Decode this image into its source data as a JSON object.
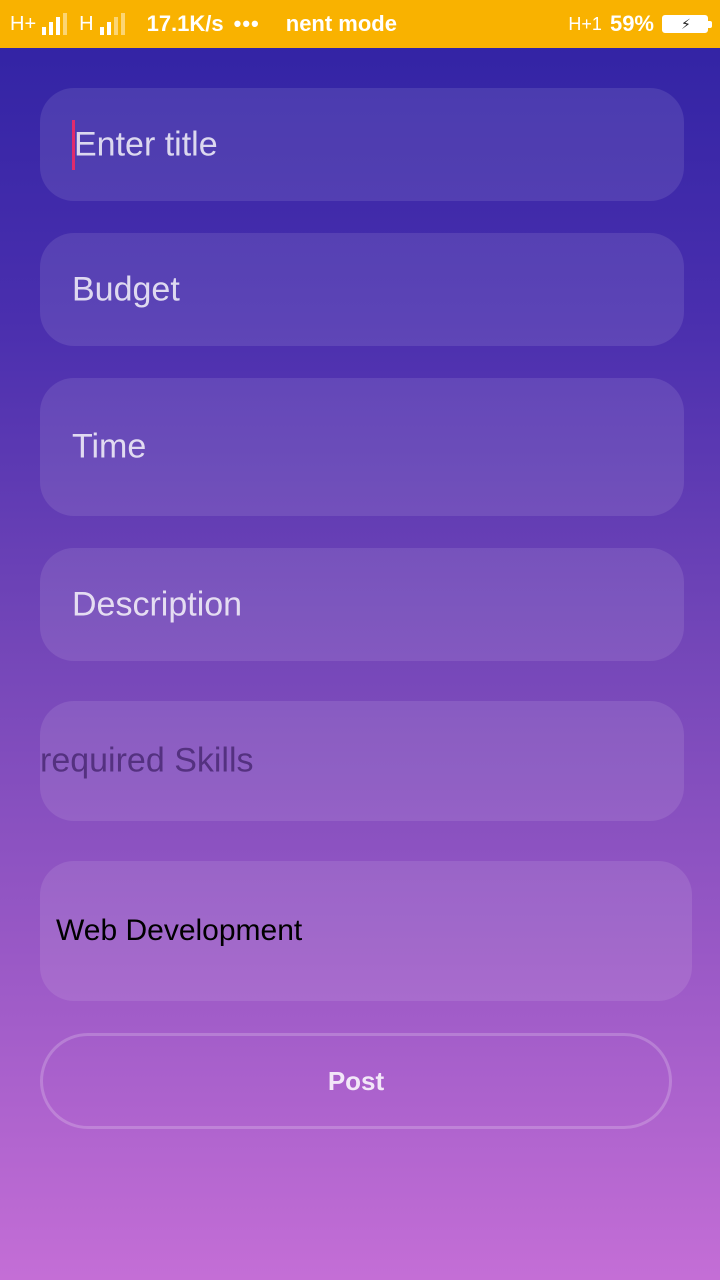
{
  "status_bar": {
    "network1": "H+",
    "network2": "H",
    "speed": "17.1K/s",
    "more": "•••",
    "mode": "nent mode",
    "network3": "H+1",
    "battery": "59%"
  },
  "form": {
    "title_placeholder": "Enter title",
    "budget_placeholder": "Budget",
    "time_placeholder": "Time",
    "description_placeholder": "Description",
    "skills_placeholder": "required Skills",
    "category_selected": "Web Development",
    "post_label": "Post"
  }
}
